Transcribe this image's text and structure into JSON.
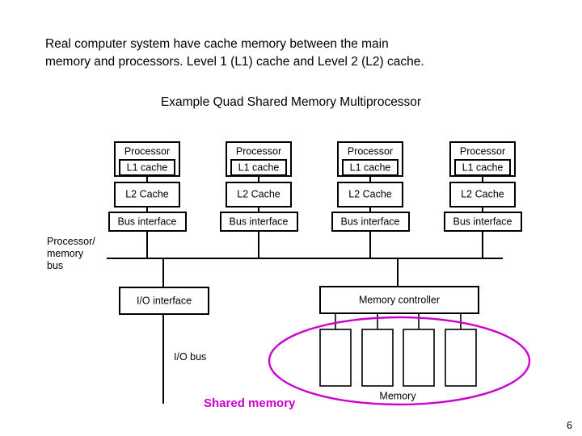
{
  "slide": {
    "intro_text": "Real computer system have cache memory between the main\nmemory and processors. Level 1 (L1) cache and Level 2 (L2) cache.",
    "example_title": "Example Quad Shared Memory Multiprocessor",
    "page_number": "6"
  },
  "diagram": {
    "columns": [
      {
        "processor_label": "Processor",
        "l1_label": "L1 cache",
        "l2_label": "L2 Cache",
        "bus_interface_label": "Bus interface"
      },
      {
        "processor_label": "Processor",
        "l1_label": "L1 cache",
        "l2_label": "L2 Cache",
        "bus_interface_label": "Bus interface"
      },
      {
        "processor_label": "Processor",
        "l1_label": "L1 cache",
        "l2_label": "L2 Cache",
        "bus_interface_label": "Bus interface"
      },
      {
        "processor_label": "Processor",
        "l1_label": "L1 cache",
        "l2_label": "L2 Cache",
        "bus_interface_label": "Bus interface"
      }
    ],
    "processor_memory_bus_label": "Processor/\nmemory\nbus",
    "processor_memory_bus_line1": "Processor/",
    "processor_memory_bus_line2": "memory",
    "processor_memory_bus_line3": "bus",
    "io_interface_label": "I/O interface",
    "memory_controller_label": "Memory controller",
    "io_bus_label": "I/O bus",
    "shared_memory_label": "Shared memory",
    "memory_label": "Memory",
    "memory_banks_count": 4,
    "colors": {
      "line": "#000000",
      "box_fill": "#ffffff",
      "highlight": "#cc00cc",
      "text": "#000000"
    }
  }
}
